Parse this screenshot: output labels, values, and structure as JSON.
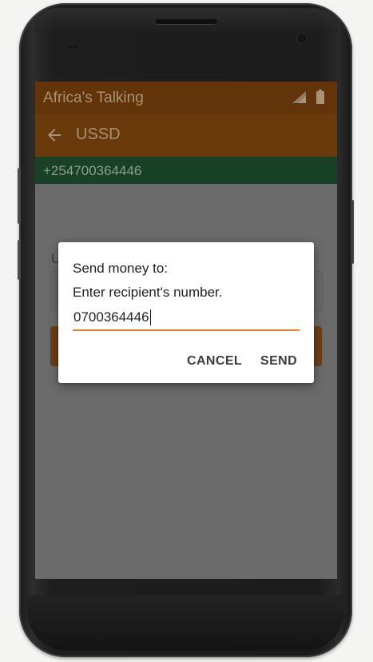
{
  "status_bar": {
    "title": "Africa's Talking",
    "signal_icon": "signal-icon",
    "battery_icon": "battery-icon"
  },
  "app_bar": {
    "back_icon": "arrow-back-icon",
    "title": "USSD"
  },
  "phone_bar": {
    "number": "+254700364446"
  },
  "background_form": {
    "label": "U"
  },
  "dialog": {
    "title": "Send money to:",
    "message": "Enter recipient's number.",
    "input_value": "0700364446",
    "cancel_label": "CANCEL",
    "send_label": "SEND"
  },
  "colors": {
    "accent": "#e8822a",
    "status_bar": "#63330a",
    "app_bar": "#6a3a0a",
    "phone_bar": "#184126",
    "scrim": "#6b6b6b"
  }
}
